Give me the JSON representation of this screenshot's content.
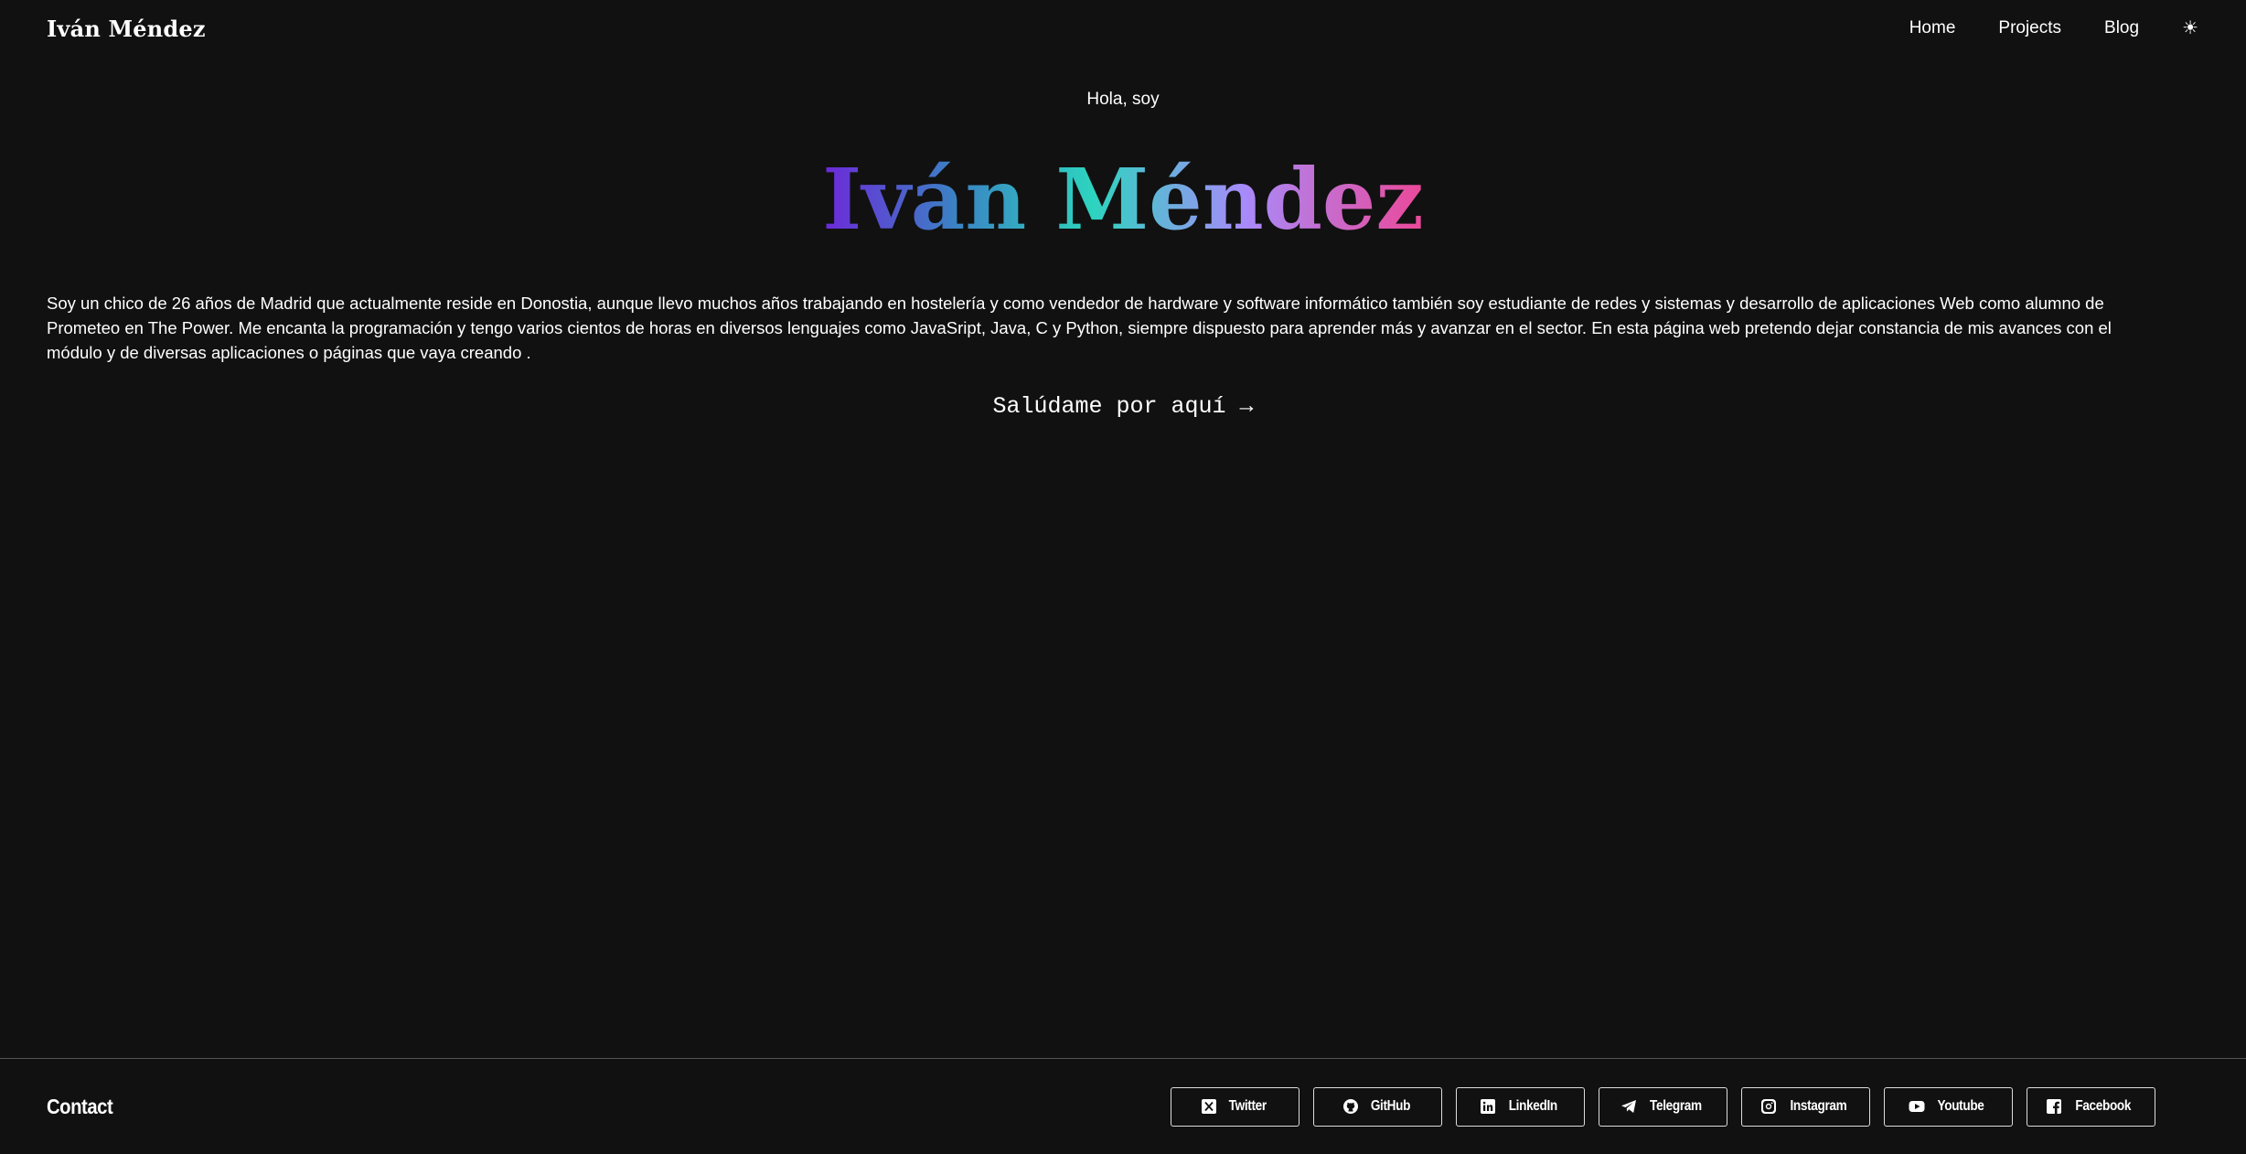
{
  "header": {
    "brand": "Iván Méndez",
    "nav": [
      {
        "label": "Home"
      },
      {
        "label": "Projects"
      },
      {
        "label": "Blog"
      }
    ],
    "theme_toggle_icon": "sun-icon",
    "theme_toggle_glyph": "☀"
  },
  "hero": {
    "greeting": "Hola, soy",
    "name": "Iván Méndez",
    "gradient_colors": [
      "#6d28d9",
      "#3b82c4",
      "#2dd4bf",
      "#a78bfa",
      "#ec4899"
    ],
    "bio": "Soy un chico de 26 años de Madrid que actualmente reside en Donostia, aunque llevo muchos años trabajando en hostelería y como vendedor de hardware y software informático también soy estudiante de redes y sistemas y desarrollo de aplicaciones Web como alumno de Prometeo en The Power. Me encanta la programación y tengo varios cientos de horas en diversos lenguajes como JavaSript, Java, C y Python, siempre dispuesto para aprender más y avanzar en el sector. En esta página web pretendo dejar constancia de mis avances con el módulo y de diversas aplicaciones o páginas que vaya creando .",
    "cta": "Salúdame por aquí →"
  },
  "footer": {
    "title": "Contact",
    "socials": [
      {
        "label": "Twitter",
        "icon": "x-twitter-icon"
      },
      {
        "label": "GitHub",
        "icon": "github-icon"
      },
      {
        "label": "LinkedIn",
        "icon": "linkedin-icon"
      },
      {
        "label": "Telegram",
        "icon": "telegram-icon"
      },
      {
        "label": "Instagram",
        "icon": "instagram-icon"
      },
      {
        "label": "Youtube",
        "icon": "youtube-icon"
      },
      {
        "label": "Facebook",
        "icon": "facebook-icon"
      }
    ]
  }
}
